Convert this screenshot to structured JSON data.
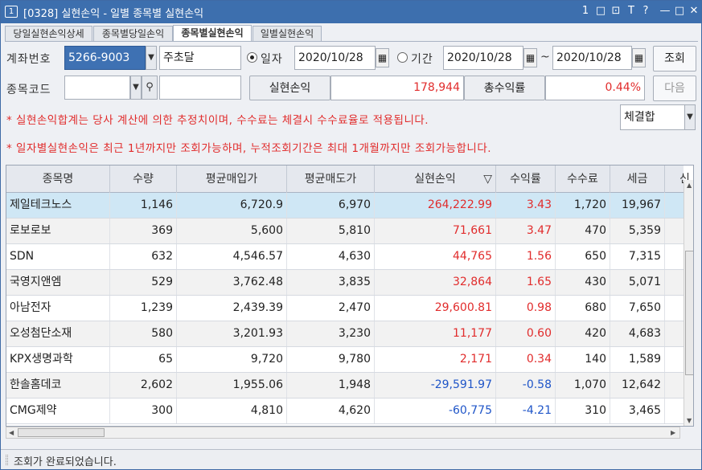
{
  "window": {
    "app_icon": "1",
    "title": "[0328] 실현손익 - 일별 종목별 실현손익",
    "controls": [
      "1",
      "□",
      "⊡",
      "T",
      "?",
      "—",
      "□",
      "✕"
    ]
  },
  "tabs": [
    {
      "label": "당일실현손익상세",
      "active": false
    },
    {
      "label": "종목별당일손익",
      "active": false
    },
    {
      "label": "종목별실현손익",
      "active": true
    },
    {
      "label": "일별실현손익",
      "active": false
    }
  ],
  "form": {
    "account_label": "계좌번호",
    "account_value": "5266-9003",
    "account_name": "주초달",
    "date_radio_label": "일자",
    "date_value": "2020/10/28",
    "period_radio_label": "기간",
    "period_from": "2020/10/28",
    "period_sep": "~",
    "period_to": "2020/10/28",
    "query_button": "조회",
    "code_label": "종목코드",
    "code_value": "",
    "code_name": "",
    "realized_label": "실현손익",
    "realized_value": "178,944",
    "return_label": "총수익률",
    "return_value": "0.44%",
    "next_button": "다음",
    "fill_select": "체결합"
  },
  "notices": [
    "* 실현손익합계는 당사 계산에 의한 추정치이며, 수수료는 체결시 수수료율로 적용됩니다.",
    "* 일자별실현손익은 최근 1년까지만 조회가능하며, 누적조회기간은 최대 1개월까지만 조회가능합니다."
  ],
  "table": {
    "headers": [
      "종목명",
      "수량",
      "평균매입가",
      "평균매도가",
      "실현손익",
      "수익률",
      "수수료",
      "세금",
      "신"
    ],
    "sort_indicator": "▽",
    "rows": [
      {
        "name": "제일테크노스",
        "qty": "1,146",
        "avg_buy": "6,720.9",
        "avg_sell": "6,970",
        "pnl": "264,222.99",
        "rate": "3.43",
        "fee": "1,720",
        "tax": "19,967",
        "sign": "pos"
      },
      {
        "name": "로보로보",
        "qty": "369",
        "avg_buy": "5,600",
        "avg_sell": "5,810",
        "pnl": "71,661",
        "rate": "3.47",
        "fee": "470",
        "tax": "5,359",
        "sign": "pos"
      },
      {
        "name": "SDN",
        "qty": "632",
        "avg_buy": "4,546.57",
        "avg_sell": "4,630",
        "pnl": "44,765",
        "rate": "1.56",
        "fee": "650",
        "tax": "7,315",
        "sign": "pos"
      },
      {
        "name": "국영지앤엠",
        "qty": "529",
        "avg_buy": "3,762.48",
        "avg_sell": "3,835",
        "pnl": "32,864",
        "rate": "1.65",
        "fee": "430",
        "tax": "5,071",
        "sign": "pos"
      },
      {
        "name": "아남전자",
        "qty": "1,239",
        "avg_buy": "2,439.39",
        "avg_sell": "2,470",
        "pnl": "29,600.81",
        "rate": "0.98",
        "fee": "680",
        "tax": "7,650",
        "sign": "pos"
      },
      {
        "name": "오성첨단소재",
        "qty": "580",
        "avg_buy": "3,201.93",
        "avg_sell": "3,230",
        "pnl": "11,177",
        "rate": "0.60",
        "fee": "420",
        "tax": "4,683",
        "sign": "pos"
      },
      {
        "name": "KPX생명과학",
        "qty": "65",
        "avg_buy": "9,720",
        "avg_sell": "9,780",
        "pnl": "2,171",
        "rate": "0.34",
        "fee": "140",
        "tax": "1,589",
        "sign": "pos"
      },
      {
        "name": "한솔홈데코",
        "qty": "2,602",
        "avg_buy": "1,955.06",
        "avg_sell": "1,948",
        "pnl": "-29,591.97",
        "rate": "-0.58",
        "fee": "1,070",
        "tax": "12,642",
        "sign": "neg"
      },
      {
        "name": "CMG제약",
        "qty": "300",
        "avg_buy": "4,810",
        "avg_sell": "4,620",
        "pnl": "-60,775",
        "rate": "-4.21",
        "fee": "310",
        "tax": "3,465",
        "sign": "neg"
      }
    ]
  },
  "status": {
    "message": "조회가 완료되었습니다."
  }
}
